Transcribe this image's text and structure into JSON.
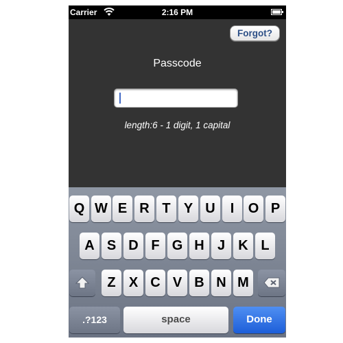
{
  "status_bar": {
    "carrier": "Carrier",
    "time": "2:16 PM",
    "icons": [
      "wifi-icon",
      "battery-icon"
    ]
  },
  "header": {
    "forgot_label": "Forgot?"
  },
  "form": {
    "title": "Passcode",
    "passcode_value": "",
    "hint": "length:6 - 1 digit, 1 capital"
  },
  "keyboard": {
    "row1": [
      "Q",
      "W",
      "E",
      "R",
      "T",
      "Y",
      "U",
      "I",
      "O",
      "P"
    ],
    "row2": [
      "A",
      "S",
      "D",
      "F",
      "G",
      "H",
      "J",
      "K",
      "L"
    ],
    "row3": [
      "Z",
      "X",
      "C",
      "V",
      "B",
      "N",
      "M"
    ],
    "shift_icon": "shift-arrow-icon",
    "delete_icon": "backspace-icon",
    "numbers_label": ".?123",
    "space_label": "space",
    "done_label": "Done"
  },
  "colors": {
    "background": "#333333",
    "accent_done": "#1d5ed8",
    "forgot_text": "#2c4f86"
  }
}
